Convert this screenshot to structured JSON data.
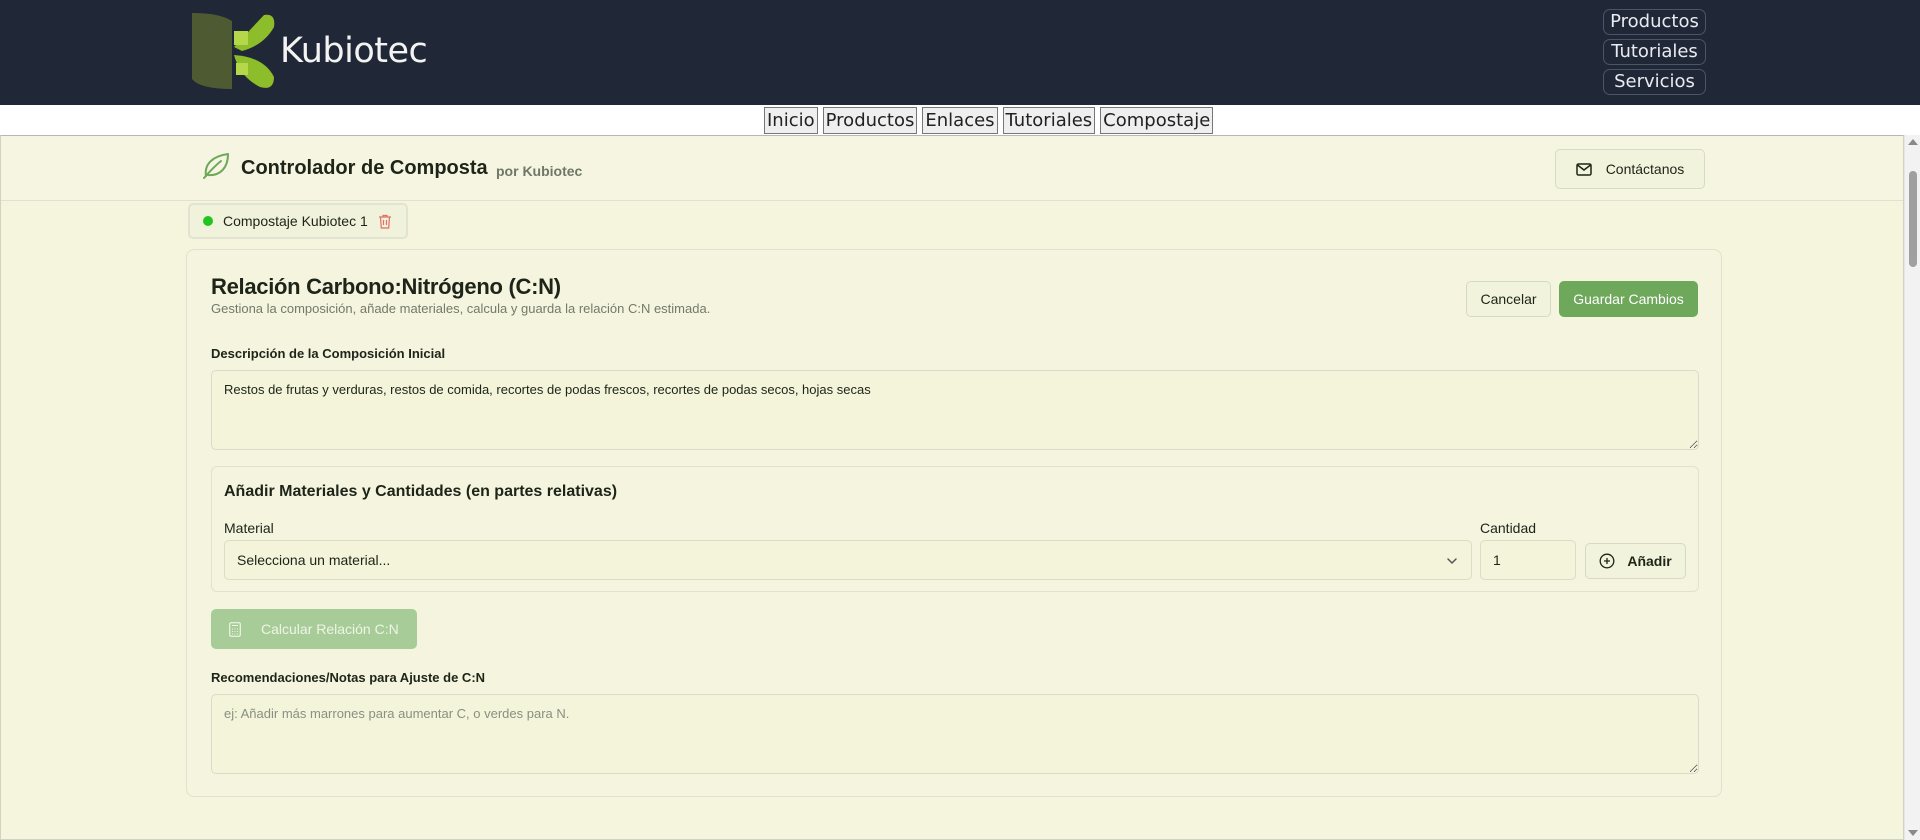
{
  "brand": {
    "name": "Kubiotec"
  },
  "top_links": [
    "Productos",
    "Tutoriales",
    "Servicios"
  ],
  "subnav": [
    "Inicio",
    "Productos",
    "Enlaces",
    "Tutoriales",
    "Compostaje"
  ],
  "app": {
    "title": "Controlador de Composta",
    "subtitle": "por Kubiotec",
    "contact_label": "Contáctanos",
    "icons": {
      "logo": "leaf-icon",
      "contact": "mail-icon"
    }
  },
  "tab": {
    "label": "Compostaje Kubiotec 1",
    "status_color": "#22c41f",
    "icon": "trash-icon"
  },
  "card": {
    "title": "Relación Carbono:Nitrógeno (C:N)",
    "description": "Gestiona la composición, añade materiales, calcula y guarda la relación C:N estimada.",
    "cancel_label": "Cancelar",
    "save_label": "Guardar Cambios",
    "composition": {
      "label": "Descripción de la Composición Inicial",
      "value": "Restos de frutas y verduras, restos de comida, recortes de podas frescos, recortes de podas secos, hojas secas"
    },
    "materials": {
      "title": "Añadir Materiales y Cantidades (en partes relativas)",
      "material_label": "Material",
      "material_placeholder": "Selecciona un material...",
      "quantity_label": "Cantidad",
      "quantity_value": "1",
      "add_label": "Añadir"
    },
    "calc_label": "Calcular Relación C:N",
    "notes": {
      "label": "Recomendaciones/Notas para Ajuste de C:N",
      "placeholder": "ej: Añadir más marrones para aumentar C, o verdes para N."
    }
  },
  "colors": {
    "header_bg": "#202838",
    "app_bg": "#f5f5de",
    "accent_green": "#6ea85a",
    "disabled_green": "#a8cc98"
  }
}
